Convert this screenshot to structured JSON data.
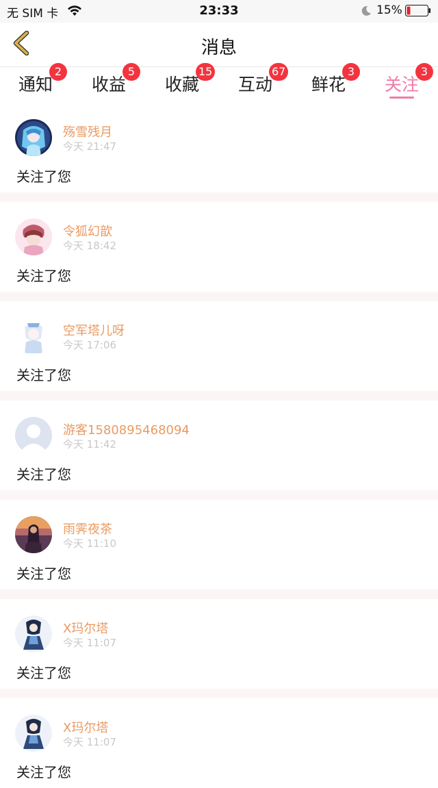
{
  "status_bar": {
    "carrier": "无 SIM 卡",
    "time": "23:33",
    "battery": "15%",
    "battery_color": "#e0242c"
  },
  "nav": {
    "title": "消息",
    "back_icon": "chevron-left-icon",
    "back_color": "#d9b24a"
  },
  "tabs": [
    {
      "label": "通知",
      "badge": "2",
      "active": false
    },
    {
      "label": "收益",
      "badge": "5",
      "active": false
    },
    {
      "label": "收藏",
      "badge": "15",
      "active": false
    },
    {
      "label": "互动",
      "badge": "67",
      "active": false
    },
    {
      "label": "鲜花",
      "badge": "3",
      "active": false
    },
    {
      "label": "关注",
      "badge": "3",
      "active": true
    }
  ],
  "colors": {
    "accent": "#f07aa8",
    "badge": "#f3343f",
    "username": "#ea9a62",
    "timestamp": "#c8c8c8",
    "separator": "#fbf5f6"
  },
  "feed": [
    {
      "username": "殇雪残月",
      "time": "今天 21:47",
      "message": "关注了您",
      "avatar": "anime-blue-avatar"
    },
    {
      "username": "令狐幻歆",
      "time": "今天 18:42",
      "message": "关注了您",
      "avatar": "anime-pink-avatar"
    },
    {
      "username": "空军塔儿呀",
      "time": "今天 17:06",
      "message": "关注了您",
      "avatar": "anime-white-avatar"
    },
    {
      "username": "游客1580895468094",
      "time": "今天 11:42",
      "message": "关注了您",
      "avatar": "default-person-avatar"
    },
    {
      "username": "雨霁夜茶",
      "time": "今天 11:10",
      "message": "关注了您",
      "avatar": "sunset-girl-avatar"
    },
    {
      "username": "X玛尔塔",
      "time": "今天 11:07",
      "message": "关注了您",
      "avatar": "anime-dark-avatar"
    },
    {
      "username": "X玛尔塔",
      "time": "今天 11:07",
      "message": "关注了您",
      "avatar": "anime-dark-avatar"
    }
  ]
}
